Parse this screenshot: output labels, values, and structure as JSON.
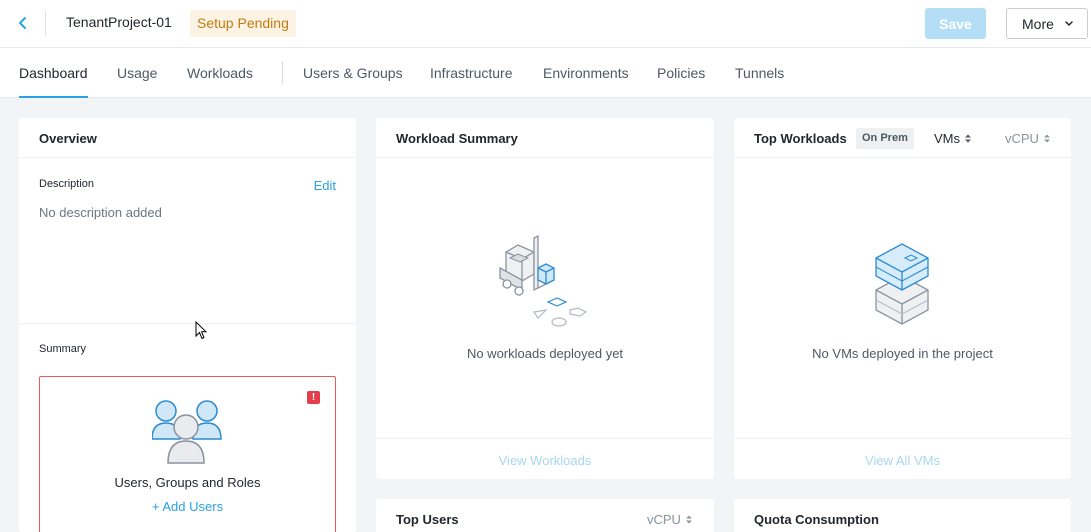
{
  "header": {
    "title": "TenantProject-01",
    "status_badge": "Setup Pending",
    "save_label": "Save",
    "more_label": "More"
  },
  "tabs": [
    {
      "label": "Dashboard",
      "active": true
    },
    {
      "label": "Usage"
    },
    {
      "label": "Workloads"
    },
    {
      "label": "Users & Groups"
    },
    {
      "label": "Infrastructure"
    },
    {
      "label": "Environments"
    },
    {
      "label": "Policies"
    },
    {
      "label": "Tunnels"
    }
  ],
  "overview": {
    "title": "Overview",
    "description_label": "Description",
    "edit_label": "Edit",
    "description_text": "No description added",
    "summary_label": "Summary",
    "summary_card": {
      "label": "Users, Groups and Roles",
      "action": "Add Users",
      "alert_icon": "!"
    }
  },
  "workload_summary": {
    "title": "Workload Summary",
    "empty_text": "No workloads deployed yet",
    "footer_link": "View Workloads"
  },
  "top_workloads": {
    "title": "Top Workloads",
    "scope_badge": "On Prem",
    "type_select": "VMs",
    "metric_select": "vCPU",
    "empty_text": "No VMs deployed in the project",
    "footer_link": "View All VMs"
  },
  "top_users": {
    "title": "Top Users",
    "metric_select": "vCPU"
  },
  "quota": {
    "title": "Quota Consumption"
  },
  "colors": {
    "accent": "#2ba0e4",
    "badge_bg": "#fcf3e4",
    "badge_text": "#c27d0e",
    "alert": "#e53e4b"
  }
}
